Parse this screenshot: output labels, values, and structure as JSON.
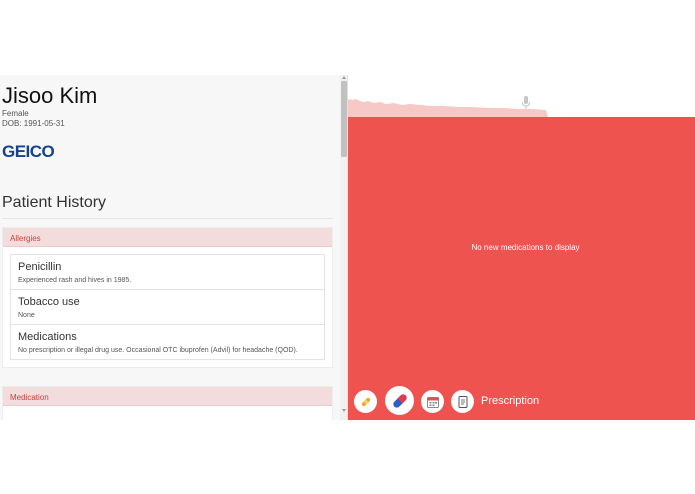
{
  "patient": {
    "name": "Jisoo Kim",
    "sex": "Female",
    "dob": "DOB: 1991-05-31",
    "insurer": "GEICO"
  },
  "history": {
    "title": "Patient History",
    "allergies": {
      "header": "Allergies",
      "entries": [
        {
          "title": "Penicillin",
          "desc": "Experienced rash and hives in 1985."
        },
        {
          "title": "Tobacco use",
          "desc": "None"
        },
        {
          "title": "Medications",
          "desc": "No prescription or illegal drug use. Occasional OTC ibuprofen (Advil) for headache (QOD)."
        }
      ]
    },
    "medication": {
      "header": "Medication"
    }
  },
  "right_panel": {
    "empty_message": "No new medications to display",
    "toolbar": {
      "active_label": "Prescription",
      "icons": [
        "bandage-icon",
        "pill-icon",
        "calendar-icon",
        "notepad-icon"
      ]
    }
  },
  "colors": {
    "accent_red": "#ee5350",
    "section_header_bg": "#f3dcdc",
    "section_header_text": "#c9433f",
    "insurer_blue": "#15418f"
  }
}
